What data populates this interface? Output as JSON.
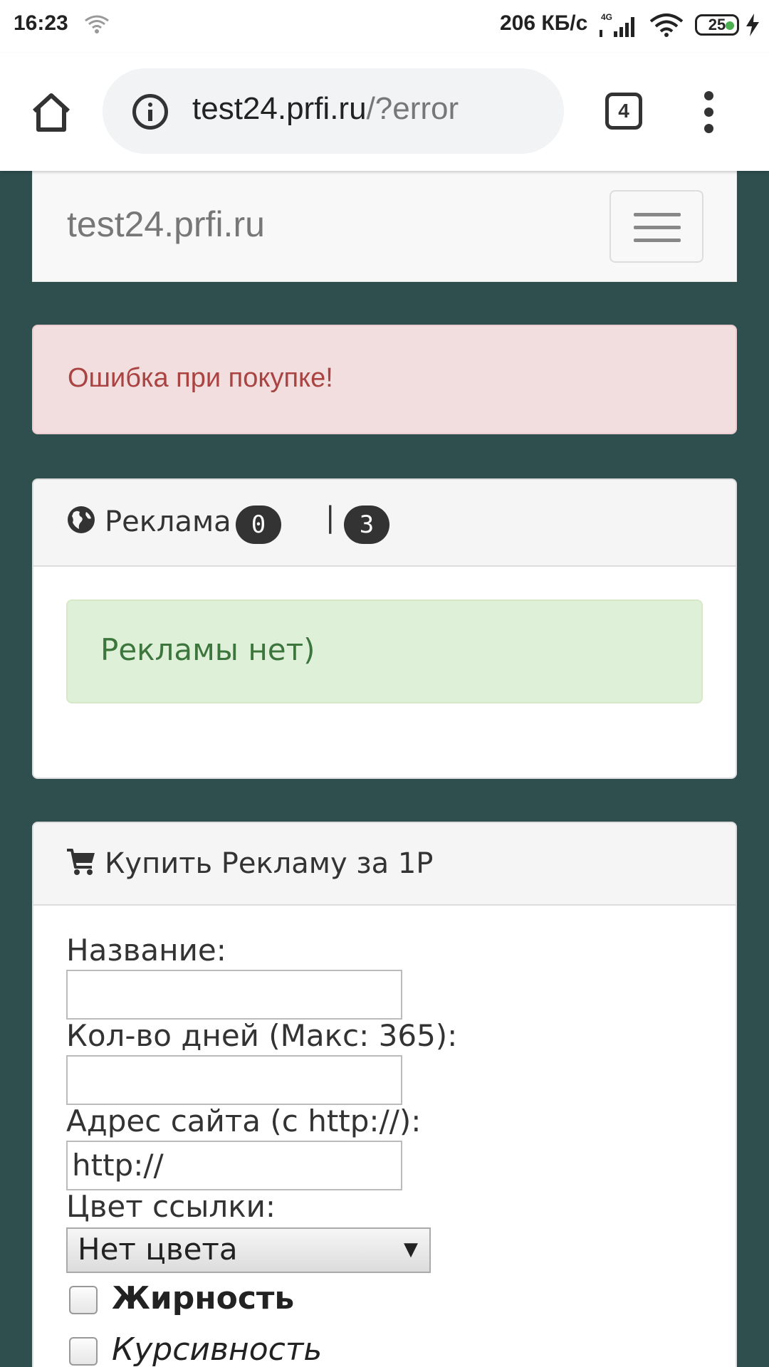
{
  "status_bar": {
    "time": "16:23",
    "speed": "206 КБ/с",
    "battery": "25",
    "icons": [
      "wifi-icon",
      "signal-4g-icon",
      "battery-icon",
      "charging-icon"
    ]
  },
  "browser": {
    "url_host": "test24.prfi.ru",
    "url_path": "/?error",
    "tab_count": "4",
    "icons": [
      "home-icon",
      "info-icon",
      "tabs-icon",
      "more-vert-icon"
    ]
  },
  "navbar": {
    "brand": "test24.prfi.ru"
  },
  "error_alert": {
    "text": "Ошибка при покупке!"
  },
  "ads_panel": {
    "title": "Реклама",
    "count_active": "0",
    "separator": "|",
    "count_total": "3",
    "empty_text": "Рекламы нет)"
  },
  "buy_panel": {
    "title": "Купить Рекламу за 1Р",
    "name_label": "Название:",
    "name_value": "",
    "days_label": "Кол-во дней (Макс: 365):",
    "days_value": "",
    "site_label": "Адрес сайта (с http://):",
    "site_value": "http://",
    "color_label": "Цвет ссылки:",
    "color_selected": "Нет цвета",
    "bold_label": "Жирность",
    "italic_label": "Курсивность"
  },
  "colors": {
    "page_bg": "#2f4f4f",
    "error_text": "#a94442",
    "error_bg": "#f2dede",
    "success_text": "#3c763d",
    "success_bg": "#dff0d8"
  }
}
